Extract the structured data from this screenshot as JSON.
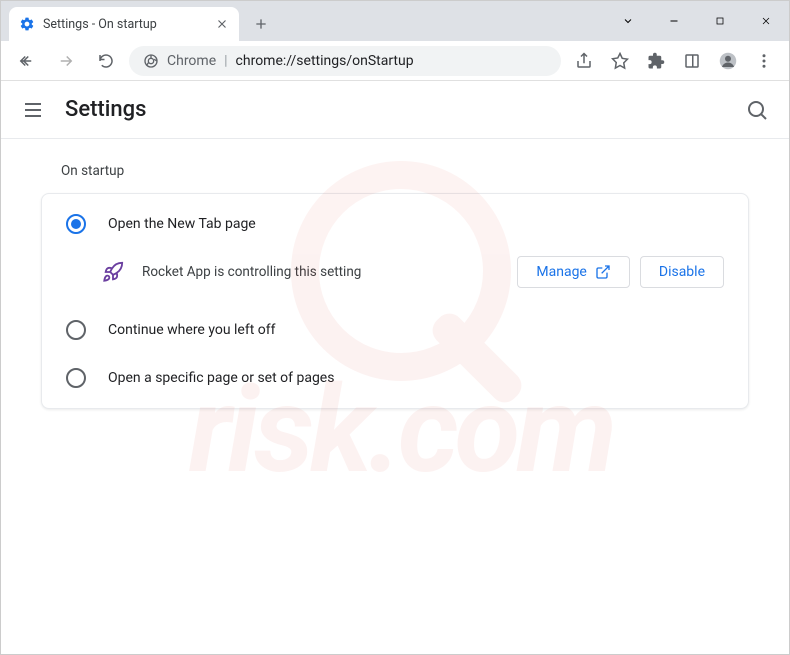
{
  "window": {
    "tab_title": "Settings - On startup"
  },
  "omnibox": {
    "scheme": "Chrome",
    "path": "chrome://settings/onStartup"
  },
  "header": {
    "title": "Settings"
  },
  "section": {
    "label": "On startup",
    "options": [
      {
        "label": "Open the New Tab page",
        "selected": true
      },
      {
        "label": "Continue where you left off",
        "selected": false
      },
      {
        "label": "Open a specific page or set of pages",
        "selected": false
      }
    ],
    "extension_notice": {
      "text": "Rocket App is controlling this setting",
      "manage_label": "Manage",
      "disable_label": "Disable"
    }
  }
}
